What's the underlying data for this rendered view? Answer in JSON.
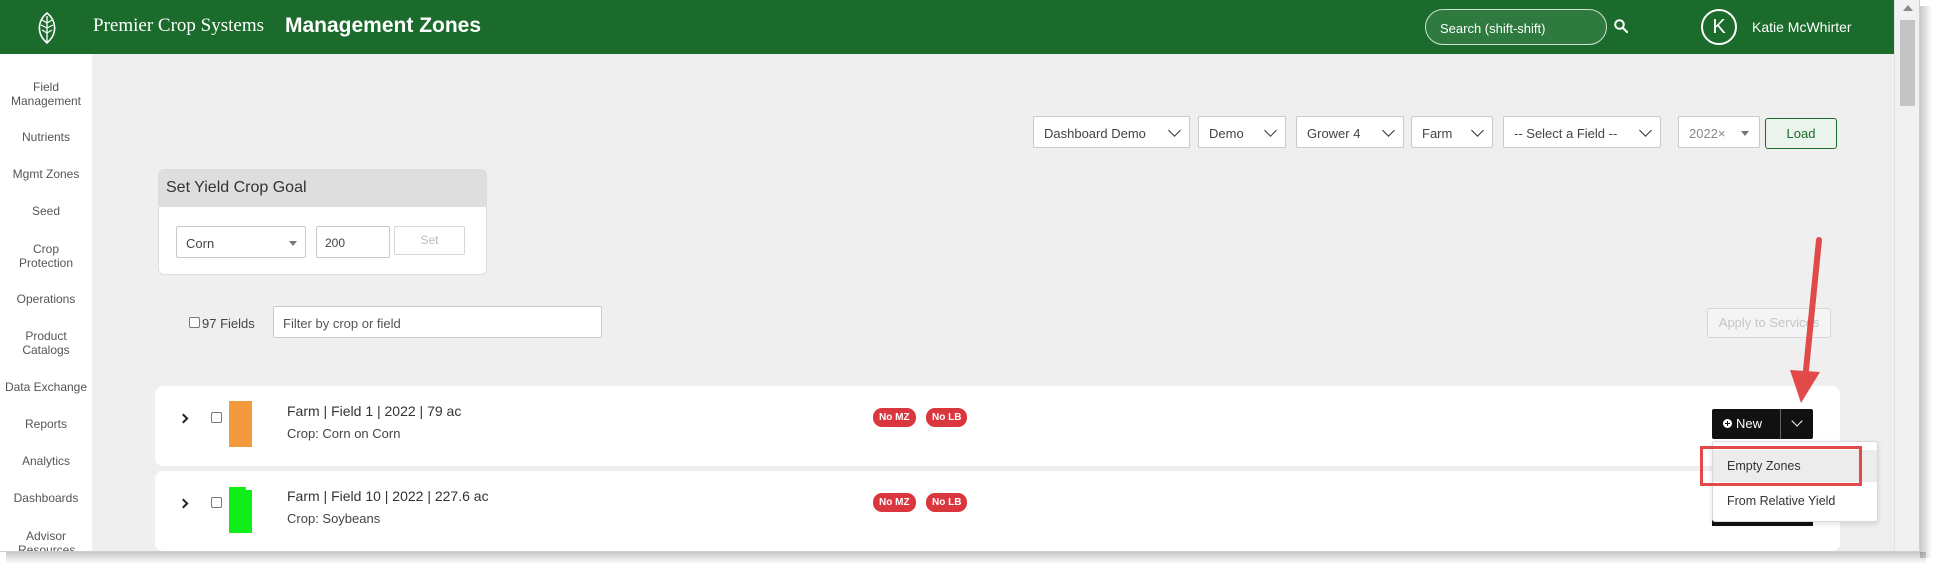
{
  "header": {
    "brand": "Premier Crop Systems",
    "title": "Management Zones",
    "search_placeholder": "Search (shift-shift)",
    "user_initial": "K",
    "user_name": "Katie McWhirter",
    "bar_color": "#1b6b2c"
  },
  "sidebar": {
    "items": [
      {
        "label": "Field Management"
      },
      {
        "label": "Nutrients"
      },
      {
        "label": "Mgmt Zones"
      },
      {
        "label": "Seed"
      },
      {
        "label": "Crop Protection"
      },
      {
        "label": "Operations"
      },
      {
        "label": "Product Catalogs"
      },
      {
        "label": "Data Exchange"
      },
      {
        "label": "Reports"
      },
      {
        "label": "Analytics"
      },
      {
        "label": "Dashboards"
      },
      {
        "label": "Advisor Resources"
      }
    ]
  },
  "filters": {
    "org": "Dashboard Demo",
    "account": "Demo",
    "grower": "Grower 4",
    "farm": "Farm",
    "field": "-- Select a Field --",
    "year": "2022×",
    "load_label": "Load"
  },
  "yield_goal": {
    "heading": "Set Yield Crop Goal",
    "crop": "Corn",
    "goal_value": "200",
    "set_label": "Set"
  },
  "list": {
    "count_label": "97 Fields",
    "filter_placeholder": "Filter by crop or field",
    "apply_label": "Apply to Services"
  },
  "fields": [
    {
      "title": "Farm | Field 1 | 2022 | 79 ac",
      "crop": "Crop: Corn on Corn",
      "swatch_color": "#f39a3c",
      "badges": [
        "No MZ",
        "No LB"
      ]
    },
    {
      "title": "Farm | Field 10 | 2022 | 227.6 ac",
      "crop": "Crop: Soybeans",
      "swatch_color": "#10ee1a",
      "badges": [
        "No MZ",
        "No LB"
      ]
    }
  ],
  "new_button": {
    "label": "New",
    "menu": [
      "Empty Zones",
      "From Relative Yield"
    ]
  },
  "annotation_color": "#e24a4a"
}
